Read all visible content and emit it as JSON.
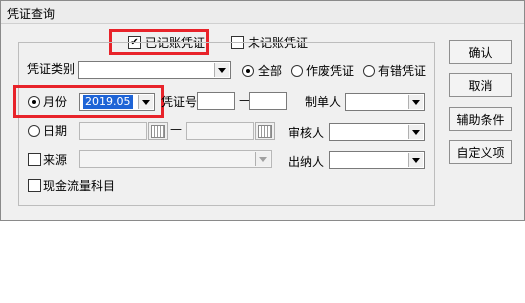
{
  "window": {
    "title": "凭证查询"
  },
  "top_options": {
    "recorded": {
      "label": "已记账凭证",
      "checked": true
    },
    "unrecorded": {
      "label": "未记账凭证",
      "checked": false
    }
  },
  "voucher_type": {
    "label": "凭证类别",
    "value": ""
  },
  "voucher_filter": {
    "all": {
      "label": "全部",
      "selected": true
    },
    "void": {
      "label": "作废凭证",
      "selected": false
    },
    "error": {
      "label": "有错凭证",
      "selected": false
    }
  },
  "period": {
    "month_label": "月份",
    "month_value": "2019.05",
    "date_label": "日期",
    "date_separator": "—"
  },
  "voucher_no": {
    "label": "凭证号",
    "separator": "—"
  },
  "source": {
    "label": "来源"
  },
  "cash_flow": {
    "label": "现金流量科目"
  },
  "people": {
    "maker": "制单人",
    "reviewer": "审核人",
    "cashier": "出纳人"
  },
  "buttons": {
    "ok": "确认",
    "cancel": "取消",
    "aux": "辅助条件",
    "custom": "自定义项"
  },
  "colors": {
    "highlight_border": "#e8232a",
    "selection": "#1e64d6"
  }
}
